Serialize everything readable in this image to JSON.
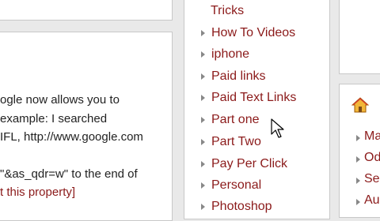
{
  "main": {
    "lines": [
      "ogle now allows you to",
      " example: I searched",
      "IFL, http://www.google.com",
      "\"&as_qdr=w\" to the end of"
    ],
    "link_fragment": "t this property]"
  },
  "sidebar": {
    "items": [
      "Tricks",
      "How To Videos",
      "iphone",
      "Paid links",
      "Paid Text Links",
      "Part one",
      "Part Two",
      "Pay Per Click",
      "Personal",
      "Photoshop"
    ]
  },
  "right": {
    "items": [
      "Ma",
      "Od",
      "Se",
      "Au"
    ]
  },
  "icons": {
    "list_arrow": "triangle-right-icon",
    "home": "home-icon",
    "cursor": "mouse-pointer-icon"
  },
  "colors": {
    "link": "#8b1a1a",
    "text": "#222222",
    "background": "#e9e9e9"
  }
}
